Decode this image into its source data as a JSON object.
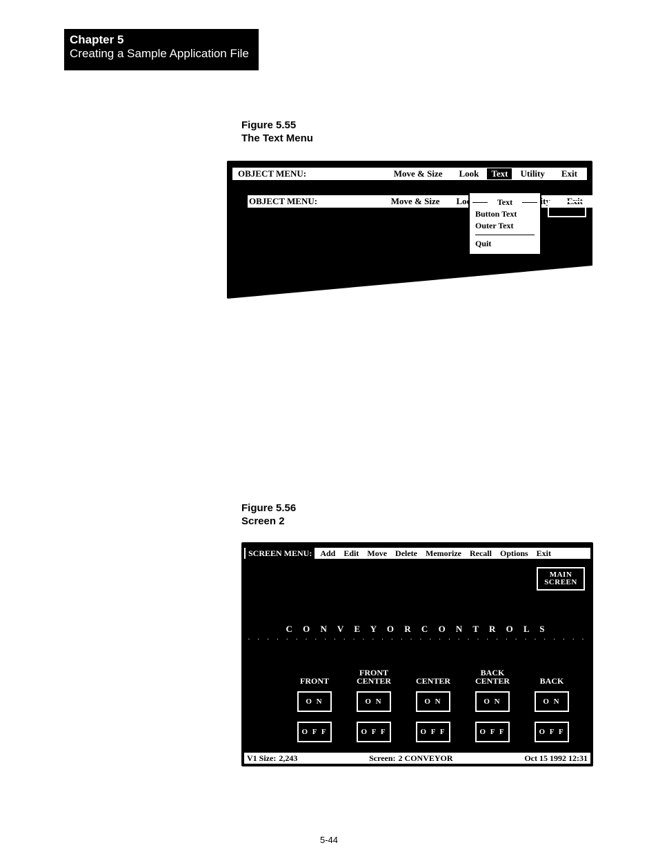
{
  "chapter": {
    "number": "Chapter 5",
    "title": "Creating a Sample Application File"
  },
  "page_number": "5-44",
  "figure55": {
    "label_line1": "Figure 5.55",
    "label_line2": "The Text Menu",
    "menubar": {
      "title": "OBJECT MENU:",
      "items": [
        "Move & Size",
        "Look",
        "Text",
        "Utility",
        "Exit"
      ],
      "selected": "Text"
    },
    "text_menu": {
      "title": "Text",
      "options": [
        "Button Text",
        "Outer Text"
      ],
      "quit": "Quit"
    }
  },
  "figure56": {
    "label_line1": "Figure 5.56",
    "label_line2": "Screen 2",
    "menubar": {
      "title": "SCREEN MENU:",
      "items": [
        "Add",
        "Edit",
        "Move",
        "Delete",
        "Memorize",
        "Recall",
        "Options",
        "Exit"
      ]
    },
    "main_screen_btn": {
      "line1": "MAIN",
      "line2": "SCREEN"
    },
    "heading": "C O N V E Y O R   C O N T R O L S",
    "columns": [
      {
        "header_top": "",
        "header_bot": "FRONT"
      },
      {
        "header_top": "FRONT",
        "header_bot": "CENTER"
      },
      {
        "header_top": "",
        "header_bot": "CENTER"
      },
      {
        "header_top": "BACK",
        "header_bot": "CENTER"
      },
      {
        "header_top": "",
        "header_bot": "BACK"
      }
    ],
    "on_label": "O N",
    "off_label": "O F F",
    "status": {
      "left_label": "V1  Size:",
      "left_value": "2,243",
      "center_label": "Screen:",
      "center_value": "2 CONVEYOR",
      "right": "Oct 15 1992 12:31"
    }
  }
}
